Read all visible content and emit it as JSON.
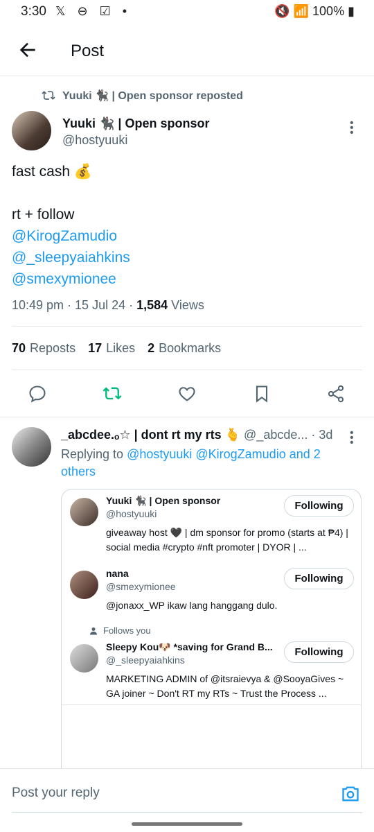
{
  "status_bar": {
    "time": "3:30",
    "left_icons": "𝕏 ⊖ ☑ •",
    "battery": "100%"
  },
  "header": {
    "title": "Post"
  },
  "repost_line": "Yuuki 🐈‍⬛ | Open sponsor reposted",
  "post": {
    "author_name": "Yuuki 🐈‍⬛ | Open sponsor",
    "author_handle": "@hostyuuki",
    "text_line1": "fast cash 💰",
    "text_line2": "rt + follow",
    "mention1": "@KirogZamudio",
    "mention2": "@_sleepyaiahkins",
    "mention3": "@smexymionee",
    "time": "10:49 pm · 15 Jul 24 · ",
    "views_count": "1,584",
    "views_label": "Views"
  },
  "stats": {
    "reposts_count": "70",
    "reposts_label": "Reposts",
    "likes_count": "17",
    "likes_label": "Likes",
    "bookmarks_count": "2",
    "bookmarks_label": "Bookmarks"
  },
  "reply": {
    "author_name": "_abcdee.ₒ☆ | dont rt my rts 🫰",
    "author_handle_time": "@_abcde... · 3d",
    "replying_prefix": "Replying to ",
    "replying_links": "@hostyuuki @KirogZamudio and 2 others"
  },
  "user_cards": [
    {
      "name": "Yuuki 🐈‍⬛ | Open sponsor",
      "handle": "@hostyuuki",
      "bio": "giveaway host 🖤 | dm sponsor for promo (starts at ₱4) | social media #crypto #nft promoter | DYOR | ...",
      "button": "Following"
    },
    {
      "name": "nana",
      "handle": "@smexymionee",
      "bio": "@jonaxx_WP ikaw lang hanggang dulo.",
      "button": "Following"
    },
    {
      "follows_you": "Follows you",
      "name": "Sleepy Kou🐶 *saving for Grand B...",
      "handle": "@_sleepyaiahkins",
      "bio": "MARKETING ADMIN of @itsraievya & @SooyaGives ~ GA joiner ~ Don't RT my RTs ~ Trust the Process ...",
      "button": "Following"
    }
  ],
  "composer": {
    "placeholder": "Post your reply"
  },
  "colors": {
    "accent": "#1d9bf0",
    "repost_green": "#00ba7c",
    "muted": "#536471"
  }
}
